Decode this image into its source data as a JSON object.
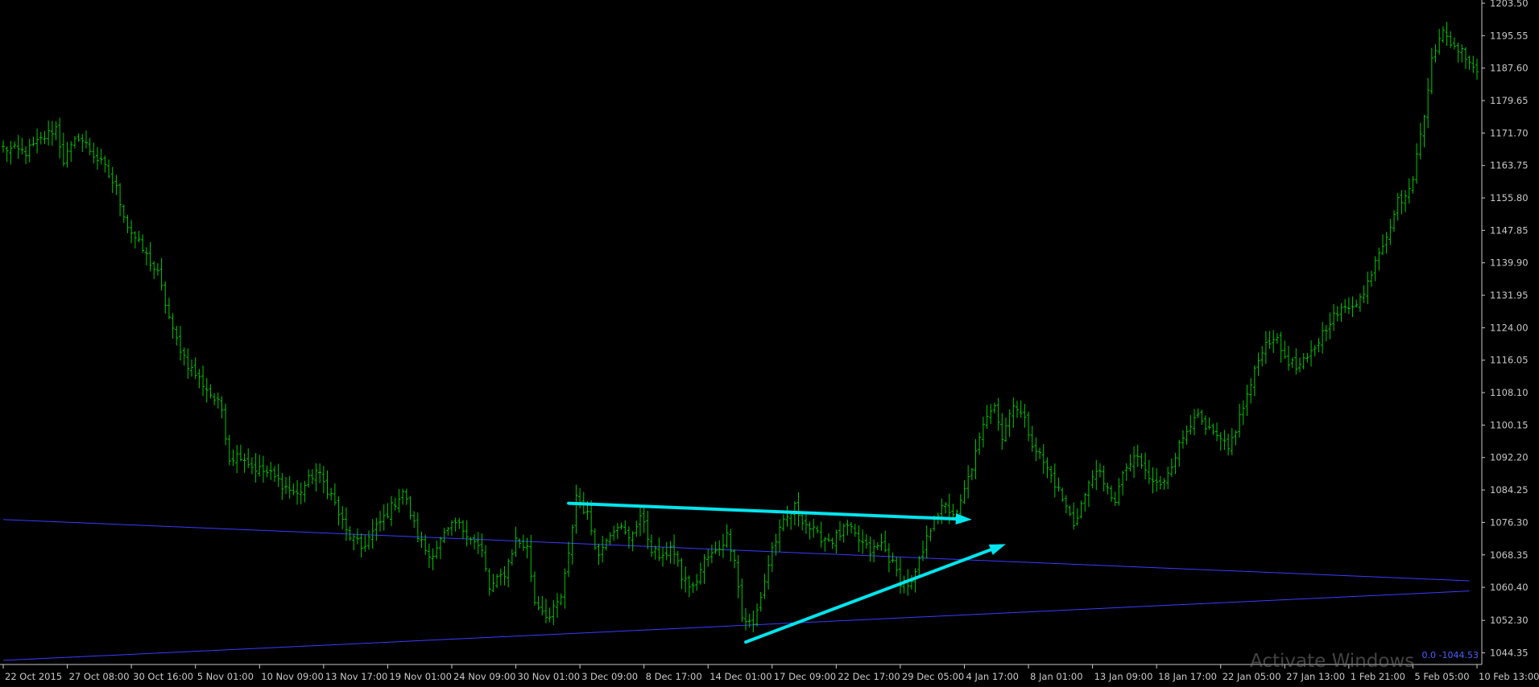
{
  "chart_data": {
    "type": "ohlc",
    "title": "",
    "xlabel": "",
    "ylabel": "",
    "grid": false,
    "colors": {
      "background": "#000000",
      "bars": "#00c800",
      "axis": "#c8c8c8",
      "arrows": "#00e5ee",
      "trendlines": "#3b3bff",
      "marker": "#4a60ff"
    },
    "price_ticks": [
      "1203.50",
      "1195.55",
      "1187.60",
      "1179.65",
      "1171.70",
      "1163.75",
      "1155.80",
      "1147.85",
      "1139.90",
      "1131.95",
      "1124.00",
      "1116.05",
      "1108.10",
      "1100.15",
      "1092.20",
      "1084.25",
      "1076.30",
      "1068.35",
      "1060.40",
      "1052.30",
      "1044.35"
    ],
    "ylim": [
      1041.5,
      1203.5
    ],
    "time_ticks": [
      "22 Oct 2015",
      "27 Oct 08:00",
      "30 Oct 16:00",
      "5 Nov 01:00",
      "10 Nov 09:00",
      "13 Nov 17:00",
      "19 Nov 01:00",
      "24 Nov 09:00",
      "30 Nov 01:00",
      "3 Dec 09:00",
      "8 Dec 17:00",
      "14 Dec 01:00",
      "17 Dec 09:00",
      "22 Dec 17:00",
      "29 Dec 05:00",
      "4 Jan 17:00",
      "8 Jan 01:00",
      "13 Jan 09:00",
      "18 Jan 17:00",
      "22 Jan 05:00",
      "27 Jan 13:00",
      "1 Feb 21:00",
      "5 Feb 05:00",
      "10 Feb 13:00"
    ],
    "price_path": [
      [
        0,
        1168
      ],
      [
        6,
        1167
      ],
      [
        14,
        1173
      ],
      [
        16,
        1165
      ],
      [
        20,
        1171
      ],
      [
        27,
        1163
      ],
      [
        30,
        1158
      ],
      [
        33,
        1149
      ],
      [
        37,
        1143
      ],
      [
        41,
        1137
      ],
      [
        45,
        1123
      ],
      [
        49,
        1115
      ],
      [
        54,
        1109
      ],
      [
        58,
        1104
      ],
      [
        60,
        1092
      ],
      [
        63,
        1093
      ],
      [
        66,
        1090
      ],
      [
        71,
        1088
      ],
      [
        75,
        1085
      ],
      [
        78,
        1083
      ],
      [
        83,
        1089
      ],
      [
        87,
        1083
      ],
      [
        91,
        1074
      ],
      [
        95,
        1070
      ],
      [
        99,
        1075
      ],
      [
        103,
        1080
      ],
      [
        106,
        1084
      ],
      [
        110,
        1073
      ],
      [
        113,
        1068
      ],
      [
        117,
        1073
      ],
      [
        120,
        1076
      ],
      [
        123,
        1074
      ],
      [
        127,
        1069
      ],
      [
        129,
        1060
      ],
      [
        133,
        1064
      ],
      [
        136,
        1072
      ],
      [
        139,
        1070
      ],
      [
        141,
        1057
      ],
      [
        145,
        1053
      ],
      [
        148,
        1058
      ],
      [
        150,
        1068
      ],
      [
        152,
        1083
      ],
      [
        155,
        1078
      ],
      [
        158,
        1068
      ],
      [
        160,
        1073
      ],
      [
        163,
        1076
      ],
      [
        166,
        1072
      ],
      [
        169,
        1078
      ],
      [
        172,
        1070
      ],
      [
        175,
        1067
      ],
      [
        177,
        1071
      ],
      [
        180,
        1063
      ],
      [
        183,
        1060
      ],
      [
        186,
        1067
      ],
      [
        189,
        1069
      ],
      [
        192,
        1073
      ],
      [
        194,
        1068
      ],
      [
        196,
        1053
      ],
      [
        199,
        1051
      ],
      [
        202,
        1062
      ],
      [
        204,
        1070
      ],
      [
        207,
        1076
      ],
      [
        210,
        1080
      ],
      [
        213,
        1076
      ],
      [
        216,
        1073
      ],
      [
        220,
        1072
      ],
      [
        224,
        1075
      ],
      [
        227,
        1072
      ],
      [
        230,
        1069
      ],
      [
        233,
        1071
      ],
      [
        236,
        1066
      ],
      [
        238,
        1062
      ],
      [
        241,
        1061
      ],
      [
        244,
        1069
      ],
      [
        247,
        1078
      ],
      [
        250,
        1080
      ],
      [
        253,
        1078
      ],
      [
        256,
        1087
      ],
      [
        258,
        1093
      ],
      [
        261,
        1103
      ],
      [
        263,
        1106
      ],
      [
        265,
        1097
      ],
      [
        268,
        1106
      ],
      [
        271,
        1101
      ],
      [
        273,
        1096
      ],
      [
        276,
        1091
      ],
      [
        279,
        1086
      ],
      [
        282,
        1080
      ],
      [
        284,
        1076
      ],
      [
        287,
        1083
      ],
      [
        290,
        1090
      ],
      [
        292,
        1085
      ],
      [
        295,
        1082
      ],
      [
        298,
        1090
      ],
      [
        301,
        1092
      ],
      [
        304,
        1087
      ],
      [
        307,
        1085
      ],
      [
        310,
        1091
      ],
      [
        313,
        1097
      ],
      [
        316,
        1103
      ],
      [
        319,
        1099
      ],
      [
        322,
        1097
      ],
      [
        325,
        1094
      ],
      [
        328,
        1102
      ],
      [
        331,
        1110
      ],
      [
        334,
        1119
      ],
      [
        337,
        1122
      ],
      [
        340,
        1117
      ],
      [
        343,
        1114
      ],
      [
        346,
        1116
      ],
      [
        349,
        1121
      ],
      [
        352,
        1126
      ],
      [
        355,
        1128
      ],
      [
        358,
        1130
      ],
      [
        361,
        1132
      ],
      [
        364,
        1141
      ],
      [
        367,
        1147
      ],
      [
        370,
        1155
      ],
      [
        373,
        1157
      ],
      [
        375,
        1166
      ],
      [
        377,
        1176
      ],
      [
        379,
        1191
      ],
      [
        382,
        1196
      ],
      [
        385,
        1193
      ],
      [
        388,
        1191
      ],
      [
        391,
        1187
      ]
    ],
    "annotations": {
      "arrows": [
        {
          "from": [
            150,
            1081
          ],
          "to": [
            257,
            1077
          ]
        },
        {
          "from": [
            197,
            1047
          ],
          "to": [
            266,
            1071
          ]
        }
      ],
      "trendlines": [
        {
          "from": [
            0,
            1077
          ],
          "to": [
            389,
            1062
          ]
        },
        {
          "from": [
            0,
            1042.5
          ],
          "to": [
            389,
            1059.5
          ]
        }
      ],
      "price_marker_label": "0.0 -1044.53"
    },
    "watermark": "Activate Windows"
  }
}
